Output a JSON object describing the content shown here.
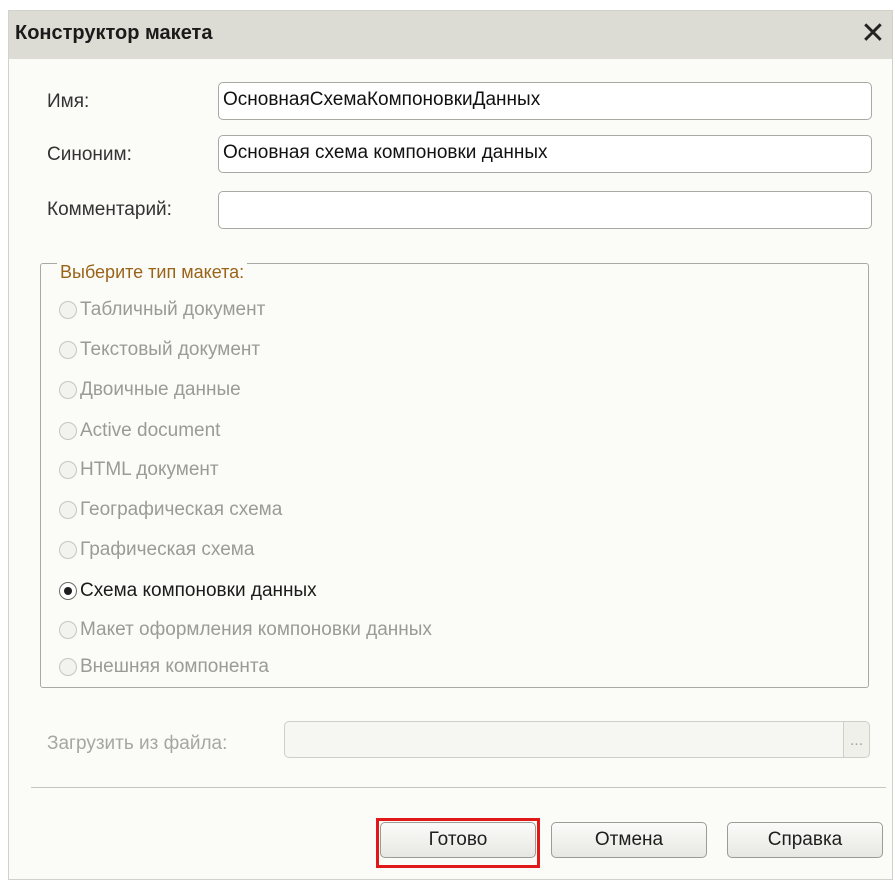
{
  "window": {
    "title": "Конструктор макета"
  },
  "fields": {
    "name": {
      "label": "Имя:",
      "value": "ОсновнаяСхемаКомпоновкиДанных"
    },
    "synonym": {
      "label": "Синоним:",
      "value": "Основная схема компоновки данных"
    },
    "comment": {
      "label": "Комментарий:",
      "value": ""
    }
  },
  "layout_type": {
    "legend": "Выберите тип макета:",
    "selected": "Схема компоновки данных",
    "options": [
      "Табличный документ",
      "Текстовый документ",
      "Двоичные данные",
      "Active document",
      "HTML документ",
      "Географическая схема",
      "Графическая схема",
      "Схема компоновки данных",
      "Макет оформления компоновки данных",
      "Внешняя компонента"
    ]
  },
  "load_file": {
    "label": "Загрузить из файла:",
    "value": "",
    "browse_label": "..."
  },
  "buttons": {
    "done": "Готово",
    "cancel": "Отмена",
    "help": "Справка"
  },
  "icons": {
    "close": "close-icon"
  },
  "colors": {
    "highlight": "#e01818",
    "legend": "#9a6418"
  }
}
